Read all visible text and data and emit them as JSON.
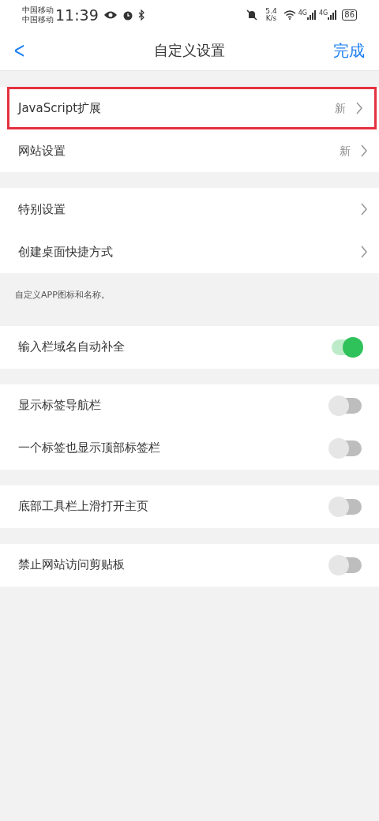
{
  "status_bar": {
    "carriers": [
      "中国移动",
      "中国移动"
    ],
    "time": "11:39",
    "speed": [
      "5.4",
      "K/s"
    ],
    "network": [
      "4G",
      "4G"
    ],
    "battery": "86"
  },
  "header": {
    "back": "<",
    "title": "自定义设置",
    "done": "完成"
  },
  "groups": [
    {
      "items": [
        {
          "kind": "link",
          "label": "JavaScript扩展",
          "badge": "新",
          "highlighted": true
        },
        {
          "kind": "link",
          "label": "网站设置",
          "badge": "新",
          "highlighted": false
        }
      ]
    },
    {
      "items": [
        {
          "kind": "link",
          "label": "特别设置",
          "highlighted": false
        },
        {
          "kind": "link",
          "label": "创建桌面快捷方式",
          "highlighted": false
        }
      ],
      "note": "自定义APP图标和名称。"
    },
    {
      "items": [
        {
          "kind": "toggle",
          "label": "输入栏域名自动补全",
          "on": true
        }
      ]
    },
    {
      "items": [
        {
          "kind": "toggle",
          "label": "显示标签导航栏",
          "on": false
        },
        {
          "kind": "toggle",
          "label": "一个标签也显示顶部标签栏",
          "on": false
        }
      ]
    },
    {
      "items": [
        {
          "kind": "toggle",
          "label": "底部工具栏上滑打开主页",
          "on": false
        }
      ]
    },
    {
      "items": [
        {
          "kind": "toggle",
          "label": "禁止网站访问剪贴板",
          "on": false
        }
      ]
    }
  ]
}
